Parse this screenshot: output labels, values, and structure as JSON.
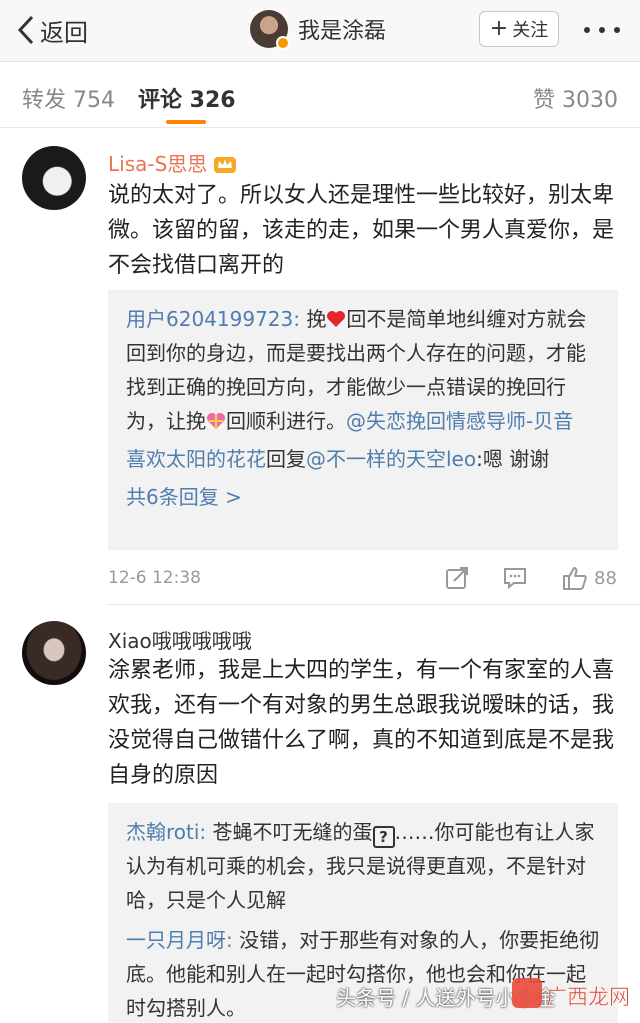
{
  "header": {
    "back_label": "返回",
    "profile_name": "我是涂磊",
    "follow_label": "关注"
  },
  "tabs": {
    "repost": "转发 754",
    "comment": "评论 326",
    "like": "赞 3030"
  },
  "comments": [
    {
      "name": "Lisa-S思思",
      "text": "说的太对了。所以女人还是理性一些比较好，别太卑微。该留的留，该走的走，如果一个男人真爱你，是不会找借口离开的",
      "replies": [
        {
          "user": "用户6204199723:",
          "seg1": " 挽",
          "seg2": "回不是简单地纠缠对方就会回到你的身边，而是要找出两个人存在的问题，才能找到正确的挽回方向，才能做少一点错误的挽回行为，让挽",
          "seg3": "回顺利进行。",
          "mention": "@失恋挽回情感导师-贝音"
        },
        {
          "user": "喜欢太阳的花花",
          "mid": "回复",
          "mention": "@不一样的天空leo",
          "text": ":嗯 谢谢"
        }
      ],
      "more_replies": "共6条回复 >",
      "time": "12-6 12:38",
      "likes": "88"
    },
    {
      "name": "Xiao哦哦哦哦哦",
      "text": "涂累老师，我是上大四的学生，有一个有家室的人喜欢我，还有一个有对象的男生总跟我说暧昧的话，我没觉得自己做错什么了啊，真的不知道到底是不是我自身的原因",
      "replies": [
        {
          "user": "杰翰roti:",
          "seg1": " 苍蝇不叮无缝的蛋",
          "box": "?",
          "seg2": "……你可能也有让人家认为有机可乘的机会，我只是说得更直观，不是针对哈，只是个人见解"
        },
        {
          "user": "一只月月呀:",
          "text": " 没错，对于那些有对象的人，你要拒绝彻底。他能和别人在一起时勾搭你，他也会和你在一起时勾搭别人。"
        }
      ]
    }
  ],
  "watermark": "头条号 / 人送外号小小金",
  "logo_text": "广西龙网",
  "colors": {
    "accent": "#ff8200",
    "link": "#507daf",
    "vip_name": "#eb7350"
  }
}
